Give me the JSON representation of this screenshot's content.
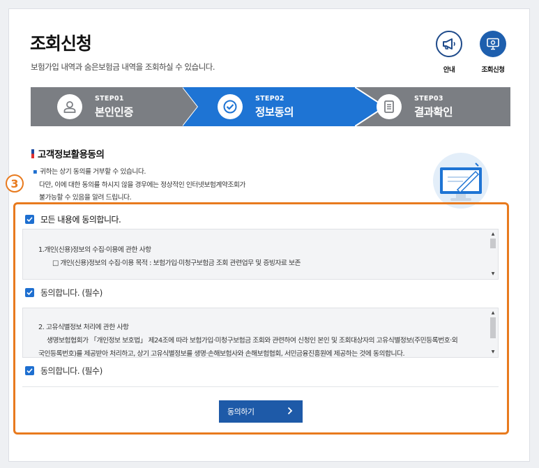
{
  "header": {
    "title": "조회신청",
    "description": "보험가입 내역과 숨은보험금 내역을 조회하실 수 있습니다."
  },
  "top_icons": {
    "guide_label": "안내",
    "inquiry_label": "조회신청"
  },
  "steps": [
    {
      "num": "STEP01",
      "name": "본인인증",
      "icon": "person-icon"
    },
    {
      "num": "STEP02",
      "name": "정보동의",
      "icon": "check-circle-icon",
      "active": true
    },
    {
      "num": "STEP03",
      "name": "결과확인",
      "icon": "document-icon"
    }
  ],
  "section": {
    "title": "고객정보활용동의",
    "notes": [
      "귀하는 상기 동의를 거부할 수 있습니다.",
      "다만, 이에 대한 동의를 하시지 않을 경우에는 정상적인 인터넷보험계약조회가",
      "불가능할 수 있음을 알려 드립니다."
    ]
  },
  "annotation": {
    "badge": "3",
    "accent": "#e87a1e"
  },
  "consent": {
    "all_label": "모든 내용에 동의합니다.",
    "term1": {
      "title": "1.개인(신용)정보의 수집·이용에 관한 사항",
      "line1": "□ 개인(신용)정보의 수집·이용 목적 : 보험가입·미청구보험금 조회 관련업무 및 증빙자료 보존"
    },
    "agree1_label": "동의합니다. (필수)",
    "term2": {
      "title": "2. 고유식별정보 처리에 관한 사항",
      "line1": "생명보험협회가 「개인정보 보호법」 제24조에 따라 보험가입·미청구보험금 조회와 관련하여 신청인 본인 및 조회대상자의 고유식별정보(주민등록번호·외",
      "line2": "국인등록번호)를 제공받아 처리하고, 상기 고유식별정보를 생명·손해보험사와 손해보험협회, 서민금융진흥원에 제공하는 것에 동의합니다."
    },
    "agree2_label": "동의합니다. (필수)",
    "agree_button": "동의하기"
  },
  "colors": {
    "primary": "#1e74d4",
    "step_bg": "#7b7e83",
    "button": "#1e5aa8"
  }
}
